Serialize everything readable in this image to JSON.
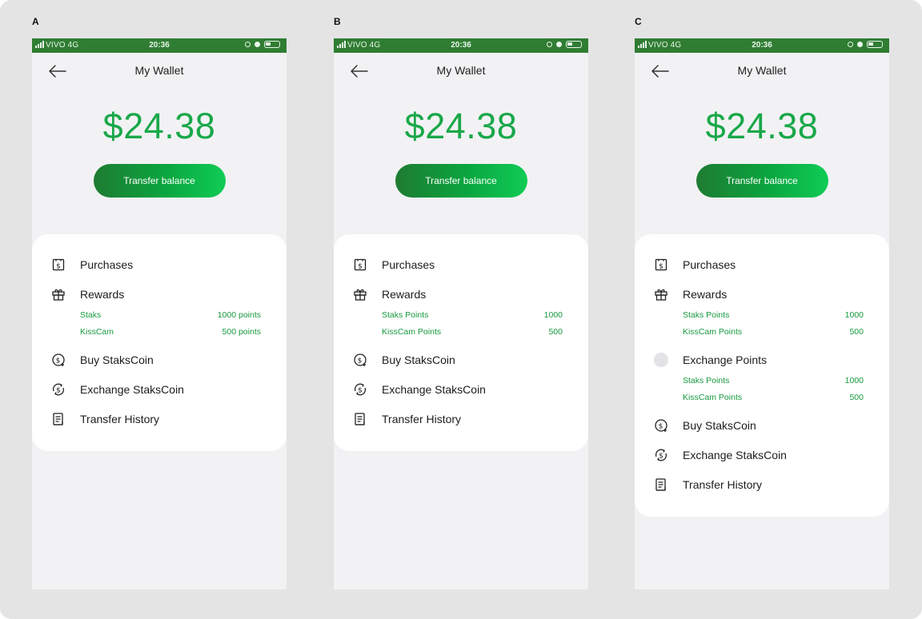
{
  "variants": [
    {
      "letter": "A",
      "status": {
        "carrier": "VIVO  4G",
        "time": "20:36"
      },
      "header": {
        "title": "My Wallet"
      },
      "balance": "$24.38",
      "transfer_label": "Transfer balance",
      "purchases": "Purchases",
      "rewards": {
        "label": "Rewards",
        "items": [
          {
            "name": "Staks",
            "value": "1000 points"
          },
          {
            "name": "KissCam",
            "value": "500 points"
          }
        ]
      },
      "buy": "Buy StaksCoin",
      "exchange": "Exchange StaksCoin",
      "history": "Transfer History"
    },
    {
      "letter": "B",
      "status": {
        "carrier": "VIVO  4G",
        "time": "20:36"
      },
      "header": {
        "title": "My Wallet"
      },
      "balance": "$24.38",
      "transfer_label": "Transfer balance",
      "purchases": "Purchases",
      "rewards": {
        "label": "Rewards",
        "items": [
          {
            "name": "Staks Points",
            "value": "1000"
          },
          {
            "name": "KissCam Points",
            "value": "500"
          }
        ]
      },
      "buy": "Buy StaksCoin",
      "exchange": "Exchange StaksCoin",
      "history": "Transfer History"
    },
    {
      "letter": "C",
      "status": {
        "carrier": "VIVO  4G",
        "time": "20:36"
      },
      "header": {
        "title": "My Wallet"
      },
      "balance": "$24.38",
      "transfer_label": "Transfer balance",
      "purchases": "Purchases",
      "rewards": {
        "label": "Rewards",
        "items": [
          {
            "name": "Staks Points",
            "value": "1000"
          },
          {
            "name": "KissCam Points",
            "value": "500"
          }
        ]
      },
      "exchange_points": {
        "label": "Exchange Points",
        "items": [
          {
            "name": "Staks Points",
            "value": "1000"
          },
          {
            "name": "KissCam Points",
            "value": "500"
          }
        ]
      },
      "buy": "Buy StaksCoin",
      "exchange": "Exchange StaksCoin",
      "history": "Transfer History"
    }
  ],
  "colors": {
    "accent": "#19a84a",
    "status_bar": "#2f7d32",
    "background": "#e4e4e4"
  },
  "icons": {
    "back": "arrow-left-icon",
    "purchases": "receipt-dollar-icon",
    "rewards": "gift-icon",
    "buy": "coin-plus-icon",
    "exchange": "coin-exchange-icon",
    "history": "document-list-icon",
    "exchange_points": "placeholder-circle-icon"
  }
}
